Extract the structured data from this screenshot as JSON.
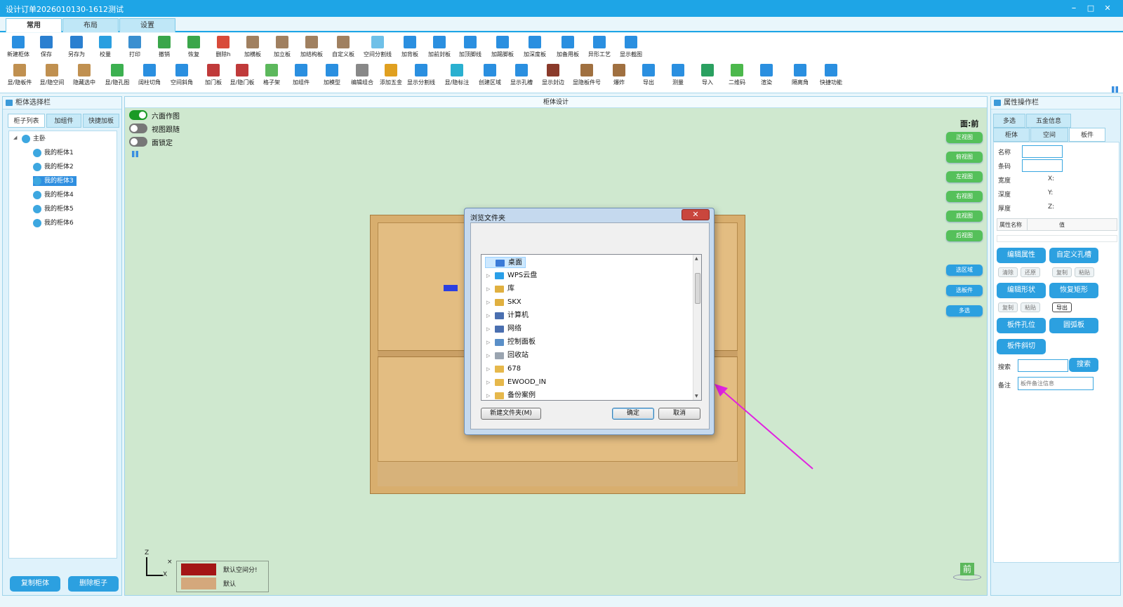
{
  "window": {
    "title": "设计订单2026010130-1612测试",
    "minimize": "–",
    "maximize": "□",
    "close": "✕"
  },
  "tabs": [
    {
      "label": "常用"
    },
    {
      "label": "布局"
    },
    {
      "label": "设置"
    }
  ],
  "toolbar_row1": [
    {
      "label": "新建柜体",
      "icon": "new-cabinet-icon",
      "color": "#2a8fe0"
    },
    {
      "label": "保存",
      "icon": "save-icon",
      "color": "#2a7fd0"
    },
    {
      "label": "另存为",
      "icon": "save-as-icon",
      "color": "#2a7fd0"
    },
    {
      "label": "校量",
      "icon": "check-icon",
      "color": "#2a9fe0"
    },
    {
      "label": "打印",
      "icon": "print-icon",
      "color": "#3a8fd0"
    },
    {
      "label": "撤销",
      "icon": "undo-icon",
      "color": "#3aa64a"
    },
    {
      "label": "恢复",
      "icon": "redo-icon",
      "color": "#3aa64a"
    },
    {
      "label": "删除h",
      "icon": "delete-icon",
      "color": "#d84a3a"
    },
    {
      "label": "加横板",
      "icon": "horizontal-board-icon",
      "color": "#a08060"
    },
    {
      "label": "加立板",
      "icon": "vertical-board-icon",
      "color": "#a08060"
    },
    {
      "label": "加结构板",
      "icon": "structure-board-icon",
      "color": "#a08060"
    },
    {
      "label": "自定义板",
      "icon": "custom-board-icon",
      "color": "#a08060"
    },
    {
      "label": "空间分割线",
      "icon": "space-split-icon",
      "color": "#6fc0e8"
    },
    {
      "label": "加背板",
      "icon": "back-board-icon",
      "color": "#2a8fe0"
    },
    {
      "label": "加前封板",
      "icon": "front-seal-icon",
      "color": "#2a8fe0"
    },
    {
      "label": "加顶脚线",
      "icon": "top-line-icon",
      "color": "#2a8fe0"
    },
    {
      "label": "加踢脚板",
      "icon": "kick-board-icon",
      "color": "#2a8fe0"
    },
    {
      "label": "加深度板",
      "icon": "depth-board-icon",
      "color": "#2a8fe0"
    },
    {
      "label": "加备用板",
      "icon": "spare-board-icon",
      "color": "#2a8fe0"
    },
    {
      "label": "异形工艺",
      "icon": "special-craft-icon",
      "color": "#2a8fe0"
    },
    {
      "label": "显示截图",
      "icon": "screenshot-icon",
      "color": "#2a8fe0"
    }
  ],
  "toolbar_row2": [
    {
      "label": "显/隐板件",
      "icon": "toggle-board-icon",
      "color": "#c09050"
    },
    {
      "label": "显/隐空间",
      "icon": "toggle-space-icon",
      "color": "#c09050"
    },
    {
      "label": "隐藏选中",
      "icon": "hide-selected-icon",
      "color": "#c09050"
    },
    {
      "label": "显/隐孔图",
      "icon": "toggle-hole-icon",
      "color": "#3cb050"
    },
    {
      "label": "阔柱切角",
      "icon": "column-cut-icon",
      "color": "#2a8fe0"
    },
    {
      "label": "空间斜角",
      "icon": "space-bevel-icon",
      "color": "#2a8fe0"
    },
    {
      "label": "加门板",
      "icon": "door-icon",
      "color": "#c03a3a"
    },
    {
      "label": "显/隐门板",
      "icon": "toggle-door-icon",
      "color": "#c03a3a"
    },
    {
      "label": "格子架",
      "icon": "grid-rack-icon",
      "color": "#5cb85c"
    },
    {
      "label": "加组件",
      "icon": "add-component-icon",
      "color": "#2a8fe0"
    },
    {
      "label": "加模型",
      "icon": "add-model-icon",
      "color": "#2a8fe0"
    },
    {
      "label": "编辑组合",
      "icon": "edit-group-icon",
      "color": "#888888"
    },
    {
      "label": "添加五金",
      "icon": "hardware-icon",
      "color": "#e0a020"
    },
    {
      "label": "显示分割线",
      "icon": "show-split-icon",
      "color": "#2a8fe0"
    },
    {
      "label": "显/隐标注",
      "icon": "toggle-label-icon",
      "color": "#2ab0d0"
    },
    {
      "label": "创建区域",
      "icon": "create-area-icon",
      "color": "#2a8fe0"
    },
    {
      "label": "显示孔槽",
      "icon": "show-hole-icon",
      "color": "#2a8fe0"
    },
    {
      "label": "显示封边",
      "icon": "show-edge-icon",
      "color": "#8a3a2a"
    },
    {
      "label": "显隐板件号",
      "icon": "board-number-icon",
      "color": "#a07040"
    },
    {
      "label": "爆炸",
      "icon": "explode-icon",
      "color": "#a07040"
    },
    {
      "label": "导出",
      "icon": "export-icon",
      "color": "#2a8fe0"
    },
    {
      "label": "测量",
      "icon": "measure-icon",
      "color": "#2a8fe0"
    },
    {
      "label": "导入",
      "icon": "import-icon",
      "color": "#2aa060"
    },
    {
      "label": "二维码",
      "icon": "qrcode-icon",
      "color": "#4cb84c"
    },
    {
      "label": "渲染",
      "icon": "render-icon",
      "color": "#2a8fe0"
    },
    {
      "label": "隔离角",
      "icon": "isolate-corner-icon",
      "color": "#2a8fe0"
    },
    {
      "label": "快捷功能",
      "icon": "shortcut-icon",
      "color": "#2a8fe0"
    }
  ],
  "left_panel": {
    "title": "柜体选择栏",
    "tabs": [
      "柜子列表",
      "加组件",
      "快捷加板"
    ],
    "tree_root": "主卧",
    "tree_items": [
      "我的柜体1",
      "我的柜体2",
      "我的柜体3",
      "我的柜体4",
      "我的柜体5",
      "我的柜体6"
    ],
    "selected_index": 2,
    "copy_button": "复制柜体",
    "delete_button": "删除柜子"
  },
  "center": {
    "title": "柜体设计",
    "toggles": [
      {
        "label": "六面作图",
        "on": true
      },
      {
        "label": "视图跟随",
        "on": false
      },
      {
        "label": "面锁定",
        "on": false
      }
    ],
    "face_label": "面:前",
    "view_buttons": [
      "正视图",
      "俯视图",
      "左视图",
      "右视图",
      "底视图",
      "后视图"
    ],
    "select_buttons": [
      "选区域",
      "选板件",
      "多选"
    ],
    "axes": {
      "z": "Z",
      "x": "X",
      "cross": "×"
    },
    "legend": [
      {
        "label": "默认空间分!",
        "color": "#a41616"
      },
      {
        "label": "默认",
        "color": "#d4a87c"
      }
    ],
    "front_badge": "前"
  },
  "right_panel": {
    "title": "属性操作栏",
    "tabs_row1": [
      "多选",
      "五金信息"
    ],
    "tabs_row2": [
      "柜体",
      "空间",
      "板件"
    ],
    "fields": {
      "name": "名称",
      "barcode": "条码",
      "width": "宽度",
      "depth": "深度",
      "thickness": "厚度"
    },
    "axes": {
      "x": "X:",
      "y": "Y:",
      "z": "Z:"
    },
    "prop_header": {
      "name": "属性名称",
      "value": "值"
    },
    "buttons": {
      "edit_attr": "编辑属性",
      "custom_hole": "自定义孔槽",
      "clear": "清除",
      "restore": "还原",
      "copy1": "复制",
      "paste1": "粘贴",
      "edit_shape": "编辑形状",
      "restore_rect": "恢复矩形",
      "copy2": "复制",
      "paste2": "粘贴",
      "export": "导出",
      "board_hole": "板件孔位",
      "arc_board": "圆弧板",
      "board_bevel": "板件斜切",
      "search": "搜索"
    },
    "search_label": "搜索",
    "note_label": "备注",
    "note_placeholder": "板件备注信息"
  },
  "dialog": {
    "title": "浏览文件夹",
    "close": "✕",
    "items": [
      {
        "label": "桌面",
        "selected": true,
        "color": "#3b7bd8"
      },
      {
        "label": "WPS云盘",
        "color": "#2a9fe8"
      },
      {
        "label": "库",
        "color": "#e0b040"
      },
      {
        "label": "SKX",
        "color": "#e0b040"
      },
      {
        "label": "计算机",
        "color": "#4a6fb0"
      },
      {
        "label": "网络",
        "color": "#4a6fb0"
      },
      {
        "label": "控制面板",
        "color": "#5a8fc8"
      },
      {
        "label": "回收站",
        "color": "#9aa4b0"
      },
      {
        "label": "678",
        "color": "#e6b84b"
      },
      {
        "label": "EWOOD_IN",
        "color": "#e6b84b"
      },
      {
        "label": "备份案例",
        "color": "#e6b84b"
      }
    ],
    "new_folder": "新建文件夹(M)",
    "ok": "确定",
    "cancel": "取消"
  }
}
